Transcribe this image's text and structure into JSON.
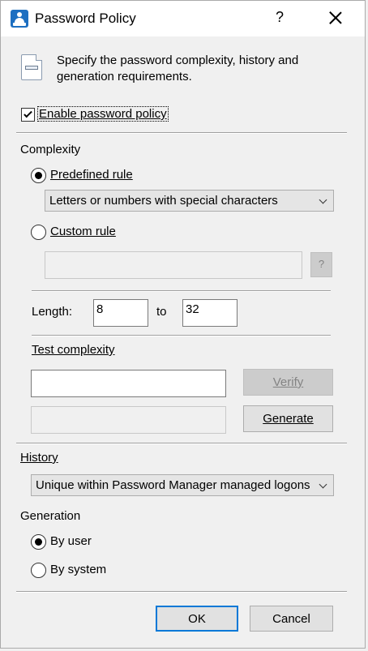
{
  "dialog": {
    "title": "Password Policy",
    "help_label": "?",
    "description": "Specify the password complexity, history and generation requirements."
  },
  "enable_policy": {
    "label": "Enable password policy",
    "checked": true
  },
  "complexity": {
    "heading": "Complexity",
    "predefined_label": "Predefined rule",
    "predefined_selected": true,
    "predefined_value": "Letters or numbers with special characters",
    "custom_label": "Custom rule",
    "custom_selected": false,
    "custom_value": "",
    "custom_help_label": "?",
    "length_label": "Length:",
    "length_min": "8",
    "length_to": "to",
    "length_max": "32",
    "test_heading": "Test complexity",
    "test_value": "",
    "verify_label": "Verify",
    "generated_value": "",
    "generate_label": "Generate"
  },
  "history": {
    "heading": "History",
    "value": "Unique within Password Manager managed logons"
  },
  "generation": {
    "heading": "Generation",
    "by_user_label": "By user",
    "by_user_selected": true,
    "by_system_label": "By system",
    "by_system_selected": false
  },
  "buttons": {
    "ok": "OK",
    "cancel": "Cancel"
  },
  "colors": {
    "accent": "#0078d7",
    "icon_blue": "#1d6fc1",
    "dialog_bg": "#f0f0f0"
  }
}
